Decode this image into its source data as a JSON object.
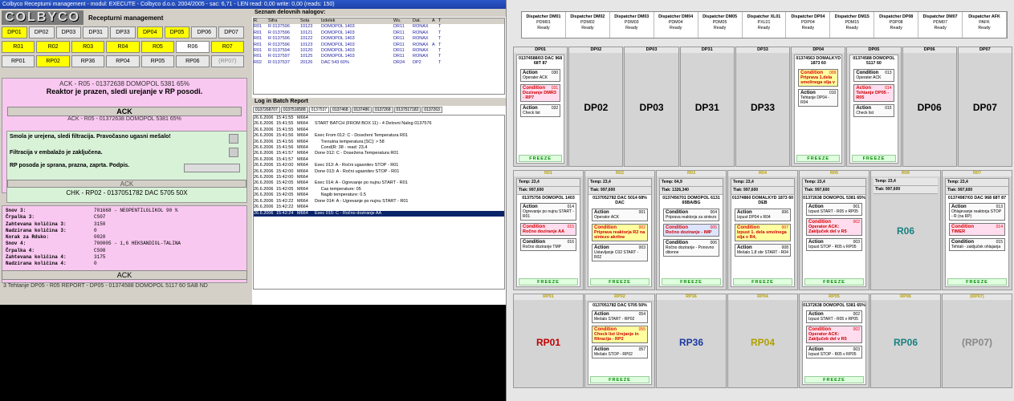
{
  "title_bar": "Colbyco Receptumi management - modul: EXECUTE - Colbyco d.o.o. 2004/2005 - sac: 6,71 - LEN read: 0,00 write: 0,00 (reads: 150)",
  "logo": "COLBYCO",
  "logo_title": "Recepturni management",
  "btn_rows": [
    [
      {
        "l": "DP01",
        "c": "y"
      },
      {
        "l": "DP02",
        "c": ""
      },
      {
        "l": "DP03",
        "c": ""
      },
      {
        "l": "DP31",
        "c": ""
      },
      {
        "l": "DP33",
        "c": ""
      },
      {
        "l": "DP04",
        "c": "y"
      },
      {
        "l": "DP05",
        "c": "y"
      },
      {
        "l": "DP06",
        "c": ""
      },
      {
        "l": "DP07",
        "c": ""
      }
    ],
    [
      {
        "l": "R01",
        "c": "y"
      },
      {
        "l": "R02",
        "c": "y"
      },
      {
        "l": "R03",
        "c": "y"
      },
      {
        "l": "R04",
        "c": "y"
      },
      {
        "l": "R05",
        "c": "y"
      },
      {
        "l": "R06",
        "c": "w"
      },
      {
        "l": "R07",
        "c": "y"
      }
    ],
    [
      {
        "l": "RP01",
        "c": ""
      },
      {
        "l": "RP02",
        "c": "y"
      },
      {
        "l": "RP36",
        "c": ""
      },
      {
        "l": "RP04",
        "c": ""
      },
      {
        "l": "RP05",
        "c": ""
      },
      {
        "l": "RP06",
        "c": ""
      },
      {
        "l": "(RP07)",
        "c": "g"
      }
    ]
  ],
  "ack1_header": "ACK - R05 - 01372638 DOMOPOL 5381 65%",
  "ack1_msg": "Reaktor je prazen, sledi urejanje v RP posodi.",
  "ack1_btn": "ACK",
  "ack2_header": "ACK - R05 - 01372638 DOMOPOL 5381 65%",
  "green_lines": [
    "Smola je urejena, sledi filtracija. Pravočasno ugasni mešalo!",
    "Filtracija v embalažo je zaključena.",
    "RP posoda je sprana, prazna, zaprta. Podpis."
  ],
  "ack3_btn": "ACK",
  "chk_header": "CHK - RP02 - 0137051782 DAC 5705 50X",
  "pink_rows": [
    [
      "Snov 3:",
      "701668 - NEOPENTILGLIKOL 90 %"
    ],
    [
      "Črpalka 3:",
      "CS07"
    ],
    [
      "Zahtevana količina 3:",
      "3150"
    ],
    [
      "Nadzirana količina 3:",
      "0"
    ],
    [
      "",
      ""
    ],
    [
      "Korak za Rdsko:",
      "0020"
    ],
    [
      "Snov 4:",
      "700005 - 1,6 HEKSANDIOL-TALINA"
    ],
    [
      "Črpalka 4:",
      "CS08"
    ],
    [
      "Zahtevana količina 4:",
      "3175"
    ],
    [
      "Nadzirana količina 4:",
      "0"
    ]
  ],
  "ack4_btn": "ACK",
  "status_line": "3 Tehtanje DP05 - R05 REPORT - DP05 - 01374588 DOMOPOL 5117 60 SAB ND",
  "orders_header": "Seznam delovnih nalogov:",
  "orders_cols": [
    "R.",
    "Šifra",
    "Šota",
    "Izdelek",
    "Ws.",
    "Dat.",
    "A",
    "T"
  ],
  "orders": [
    [
      "R01",
      "R 0137596",
      "10123",
      "DOMOPOL 1403",
      "DR11",
      "RONAX",
      "",
      "T"
    ],
    [
      "R01",
      "R 0137596",
      "10121",
      "DOMOPOL 1403",
      "DR11",
      "RONAX",
      "",
      "T"
    ],
    [
      "R01",
      "R 0137596",
      "10122",
      "DOMOPOL 1403",
      "DR11",
      "RONAX",
      "",
      "T"
    ],
    [
      "R01",
      "R 0137596",
      "10123",
      "DOMOPOL 1403",
      "DR11",
      "RONAX",
      "A",
      "T"
    ],
    [
      "R01",
      "R 0137594",
      "10120",
      "DOMOPOL 1403",
      "DR11",
      "RONAX",
      "",
      "T"
    ],
    [
      "R01",
      "R 0137597",
      "10125",
      "DOMOPOL 1403",
      "DR11",
      "RONAX",
      "",
      "T"
    ],
    [
      "R02",
      "R 0137537",
      "20126",
      "DAC 543 60%",
      "DR24",
      "DP2",
      "",
      "T"
    ]
  ],
  "log_header": "Log in Batch Report",
  "log_tabs": [
    "0137268707",
    "0137516588",
    "0137537",
    "0137468",
    "0137486",
    "0137268",
    "0137517182",
    "0137263"
  ],
  "log_rows": [
    [
      "26.6.2006",
      "15:41:55",
      "M664",
      ""
    ],
    [
      "26.6.2006",
      "15:41:55",
      "M664",
      "START BATCH (FROM BOX 11) - 4 Delovni Nalog 0137576"
    ],
    [
      "26.6.2006",
      "15:41:55",
      "M664",
      ""
    ],
    [
      "26.6.2006",
      "15:41:56",
      "M664",
      "Exec From 012: C - Doseženi Temperatura R01"
    ],
    [
      "26.6.2006",
      "15:41:56",
      "M664",
      "     Trenutna temperatura [ŠC]: > 58"
    ],
    [
      "26.6.2006",
      "15:41:56",
      "M664",
      "     Cond(R: 38 - read: 23,4"
    ],
    [
      "26.6.2006",
      "15:41:57",
      "M664",
      "Done 012: C - Dosežena Temperatura R01"
    ],
    [
      "26.6.2006",
      "15:41:57",
      "M664",
      ""
    ],
    [
      "26.6.2006",
      "15:42:00",
      "M664",
      "Exec 013: A - Ročni ugasnitev STOP - R01"
    ],
    [
      "26.6.2006",
      "15:42:00",
      "M664",
      "Done 013: A - Ročni ugasnitev STOP - R01"
    ],
    [
      "26.6.2006",
      "15:42:00",
      "M664",
      ""
    ],
    [
      "26.6.2006",
      "15:42:05",
      "M664",
      "Exec 014: A - Ogrevanje po nujnu START - R01"
    ],
    [
      "26.6.2006",
      "15:42:05",
      "M664",
      "     Čas temperature: 05"
    ],
    [
      "26.6.2006",
      "15:42:05",
      "M664",
      "     Nagib temperature: 0.5"
    ],
    [
      "26.6.2006",
      "15:42:22",
      "M664",
      "Done 014: A - Ugrevanje po nujnu START - R01"
    ],
    [
      "26.6.2006",
      "15:42:22",
      "M664",
      ""
    ],
    [
      "26.6.2006",
      "15:42:24",
      "M664",
      "Exec 015: C - Ročno doziranje AA"
    ]
  ],
  "dispatchers": [
    [
      "Dispatcher DM01",
      "PDM01",
      "Ready"
    ],
    [
      "Dispatcher DM02",
      "PDM02",
      "Ready"
    ],
    [
      "Dispatcher DM03",
      "PDM03",
      "Ready"
    ],
    [
      "Dispatcher DM04",
      "PDM04",
      "Ready"
    ],
    [
      "Dispatcher DM05",
      "PDM05",
      "Ready"
    ],
    [
      "Dispatcher XL01",
      "PXL01",
      "Ready"
    ],
    [
      "Dispatcher DP04",
      "PDP04",
      "Ready"
    ],
    [
      "Dispatcher DM15",
      "PDM15",
      "Ready"
    ],
    [
      "Dispatcher DP08",
      "PDP08",
      "Ready"
    ],
    [
      "Dispatcher DM07",
      "PDM07",
      "Ready"
    ],
    [
      "Dispatcher AFK",
      "PAFK",
      "Ready"
    ]
  ],
  "dp_zone": [
    {
      "h": "DP01",
      "sub": "01374588/03 DAC 968 68T 87",
      "cards": [
        {
          "k": "act",
          "t": "Action",
          "n": "030",
          "x": "Operater ACK"
        },
        {
          "k": "cond",
          "t": "Condition",
          "n": "031",
          "x": "Doziranje DMR3 - RP7"
        },
        {
          "k": "act",
          "t": "Action",
          "n": "032",
          "x": "Check list"
        }
      ],
      "freeze": "FREEZE"
    },
    {
      "h": "DP02",
      "big": "DP02"
    },
    {
      "h": "DP03",
      "big": "DP03"
    },
    {
      "h": "DP31",
      "big": "DP31"
    },
    {
      "h": "DP33",
      "big": "DP33"
    },
    {
      "h": "DP04",
      "sub": "01374563 DOMALKYD 1873 60",
      "cards": [
        {
          "k": "cond yellow",
          "t": "Condition",
          "n": "009",
          "x": "Priprava 1.dela smolinega olja v"
        },
        {
          "k": "act",
          "t": "Action",
          "n": "010",
          "x": "Tehtanje DP04 - R04"
        }
      ],
      "freeze": "FREEZE"
    },
    {
      "h": "DP05",
      "sub": "01374588 DOMOPOL 5117 60",
      "cards": [
        {
          "k": "act",
          "t": "Condition",
          "n": "013",
          "x": "Operater ACK"
        },
        {
          "k": "cond",
          "t": "Action",
          "n": "014",
          "x": "Tehtanje DP05 - R05"
        },
        {
          "k": "act",
          "t": "Action",
          "n": "015",
          "x": "Check list"
        }
      ],
      "freeze": "FREEZE"
    },
    {
      "h": "DP06",
      "big": "DP06"
    },
    {
      "h": "DP07",
      "big": "DP07"
    }
  ],
  "r_zone": [
    {
      "h": "R01",
      "temp": "Temp: 23,4",
      "tlak": "Tlak: 997,600",
      "sub": "01375756 DOMOPOL 1403",
      "cards": [
        {
          "k": "act",
          "t": "Action",
          "n": "014",
          "x": "Ogrevanje po nujnu START - R01"
        },
        {
          "k": "cond",
          "t": "Condition",
          "n": "015",
          "x": "Ročno doziranje AA"
        },
        {
          "k": "act",
          "t": "Condition",
          "n": "016",
          "x": "Ročno doziranje TMP"
        }
      ],
      "freeze": "FREEZE"
    },
    {
      "h": "R02",
      "temp": "Temp: 23,4",
      "tlak": "Tlak: 997,600",
      "sub": "0137052782 DAC 5014 68% DAC",
      "cards": [
        {
          "k": "act",
          "t": "Action",
          "n": "001",
          "x": "Operator ACK"
        },
        {
          "k": "cond yellow",
          "t": "Condition",
          "n": "002",
          "x": "Priprava reaktorja R2 na sintezo akrilne"
        },
        {
          "k": "act",
          "t": "Action",
          "n": "003",
          "x": "Ustavljanje C02 START - R02"
        }
      ],
      "freeze": "FREEZE"
    },
    {
      "h": "R03",
      "temp": "Temp: 64,9",
      "tlak": "Tlak: 1326,340",
      "sub": "0137456701 DOMOPOL 6131 65BA/BG",
      "cards": [
        {
          "k": "act",
          "t": "Condition",
          "n": "004",
          "x": "Priprava reaktorja za sintezo"
        },
        {
          "k": "cond blue",
          "t": "Condition",
          "n": "005",
          "x": "Ročno doziranje - IMP"
        },
        {
          "k": "act",
          "t": "Condition",
          "n": "006",
          "x": "Ročno doziranje - Ponovno ditonne"
        }
      ],
      "freeze": "FREEZE"
    },
    {
      "h": "R04",
      "temp": "Temp: 23,4",
      "tlak": "Tlak: 997,600",
      "sub": "01374860 DOMALKYD 1873 60 DEB",
      "cards": [
        {
          "k": "act",
          "t": "Action",
          "n": "006",
          "x": "Izpust DP04 v R04"
        },
        {
          "k": "cond yellow",
          "t": "Condition",
          "n": "007",
          "x": "Izpust 1. dela smolnega olja v R4,"
        },
        {
          "k": "act",
          "t": "Action",
          "n": "008",
          "x": "Mešalo 1,8 obr START - R04"
        }
      ],
      "freeze": "FREEZE"
    },
    {
      "h": "R05",
      "temp": "Temp: 23,4",
      "tlak": "Tlak: 997,600",
      "sub": "01372638 DOMOPOL 5381 65%",
      "cards": [
        {
          "k": "act",
          "t": "Action",
          "n": "001",
          "x": "Izpust START - R05 v RP05"
        },
        {
          "k": "cond",
          "t": "Condition",
          "n": "002",
          "x": "Operator ACK: Zaključek del v R5"
        },
        {
          "k": "act",
          "t": "Action",
          "n": "003",
          "x": "Izpust STOP - R05 v RP05"
        }
      ],
      "freeze": "FREEZE"
    },
    {
      "h": "R06",
      "temp": "Temp: 23,4",
      "tlak": "Tlak: 997,600",
      "big": "R06"
    },
    {
      "h": "R07",
      "temp": "Temp: 23,4",
      "tlak": "Tlak: 997,600",
      "sub": "01374987/03 DAC 968 68T 87",
      "cards": [
        {
          "k": "act",
          "t": "Action",
          "n": "013",
          "x": "Ohlajevanje reaktorja STOP - R (na RP)"
        },
        {
          "k": "cond",
          "t": "Condition",
          "n": "014",
          "x": "TIMER"
        },
        {
          "k": "act",
          "t": "Condition",
          "n": "015",
          "x": "Tehtati - zaključek ohlajanja"
        }
      ],
      "freeze": "FREEZE"
    }
  ],
  "rp_zone": [
    {
      "h": "RP01",
      "big": "RP01",
      "col": "#c00000"
    },
    {
      "h": "RP02",
      "sub": "0137051782 DAC 5705 50%",
      "cards": [
        {
          "k": "act",
          "t": "Action",
          "n": "054",
          "x": "Mešalo START - RP02"
        },
        {
          "k": "cond yellow",
          "t": "Condition",
          "n": "055",
          "x": "Check list Urejanje in filtracija - RP2"
        },
        {
          "k": "act",
          "t": "Action",
          "n": "057",
          "x": "Mešalo STOP - RP02"
        }
      ],
      "freeze": "FREEZE"
    },
    {
      "h": "RP36",
      "big": "RP36",
      "col": "#1a3aa0"
    },
    {
      "h": "RP04",
      "big": "RP04",
      "col": "#b0a000"
    },
    {
      "h": "RP05",
      "sub": "01372638 DOMOPOL 5381 65%",
      "cards": [
        {
          "k": "act",
          "t": "Action",
          "n": "002",
          "x": "Izpust START - R05 v RP05"
        },
        {
          "k": "cond",
          "t": "Condition",
          "n": "002",
          "x": "Operator ACK: Zaključek del v R5"
        },
        {
          "k": "act",
          "t": "Action",
          "n": "003",
          "x": "Izpust STOP - R05 v RP05"
        }
      ],
      "freeze": "FREEZE"
    },
    {
      "h": "RP06",
      "big": "RP06",
      "col": "#1a8080"
    },
    {
      "h": "(RP07)",
      "big": "(RP07)",
      "col": "#888888"
    }
  ]
}
